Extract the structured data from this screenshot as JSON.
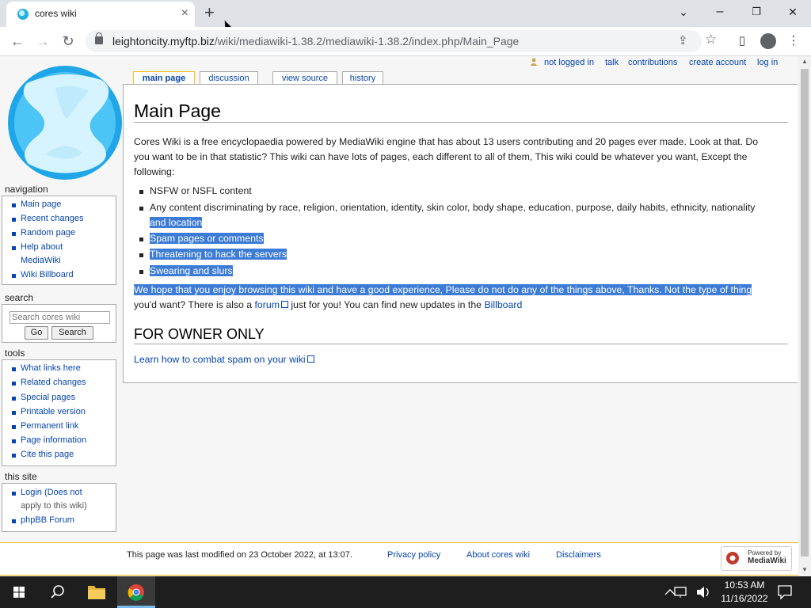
{
  "browser": {
    "tab_title": "cores wiki",
    "tab_close": "×",
    "new_tab": "+",
    "url_host": "leightoncity.myftp.biz",
    "url_path": "/wiki/mediawiki-1.38.2/mediawiki-1.38.2/index.php/Main_Page",
    "buttons": {
      "back": "←",
      "forward": "→",
      "reload": "↻",
      "minimize": "–",
      "restore": "❐",
      "close": "✕",
      "tab_search": "⌄",
      "menu": "⋮",
      "share": "⇪",
      "star": "☆",
      "sidepanel": "▯"
    }
  },
  "personal": {
    "not_logged_in": "not logged in",
    "talk": "talk",
    "contributions": "contributions",
    "create_account": "create account",
    "log_in": "log in"
  },
  "page_tabs": {
    "main_page": "main page",
    "discussion": "discussion",
    "view_source": "view source",
    "history": "history"
  },
  "article": {
    "title": "Main Page",
    "intro_1": "Cores Wiki is a free encyclopaedia powered by MediaWiki engine that has about 13 users contributing and 20 pages ever made. Look at that. Do",
    "intro_2": "you want to be in that statistic? This wiki can have lots of pages, each different to all of them, This wiki could be whatever you want, Except the",
    "intro_3": "following:",
    "list": [
      "NSFW or NSFL content",
      "Any content discriminating by race, religion, orientation, identity, skin color, body shape, education, purpose, daily habits, ethnicity, nationality",
      "and location",
      "Spam pages or comments",
      "Threatening to hack the servers",
      "Swearing and slurs"
    ],
    "outro_1": "We hope that you enjoy browsing this wiki and have a good experience, Please do not do any of the things above, Thanks. Not the type of thing",
    "outro_2a": "you'd want? There is also a ",
    "outro_forum": "forum",
    "outro_2b": " just for you! You can find new updates in the ",
    "outro_billboard": "Billboard",
    "h2": "FOR OWNER ONLY",
    "spam_link": "Learn how to combat spam on your wiki"
  },
  "sidebar": {
    "navigation": {
      "title": "navigation",
      "items": [
        "Main page",
        "Recent changes",
        "Random page",
        "Help about",
        "MediaWiki",
        "Wiki Billboard"
      ]
    },
    "search": {
      "title": "search",
      "placeholder": "Search cores wiki",
      "go": "Go",
      "search": "Search"
    },
    "tools": {
      "title": "tools",
      "items": [
        "What links here",
        "Related changes",
        "Special pages",
        "Printable version",
        "Permanent link",
        "Page information",
        "Cite this page"
      ]
    },
    "this_site": {
      "title": "this site",
      "items": [
        "Login (Does not",
        "apply to this wiki)",
        "phpBB Forum"
      ]
    }
  },
  "footer": {
    "last_modified": "This page was last modified on 23 October 2022, at 13:07.",
    "privacy": "Privacy policy",
    "about": "About cores wiki",
    "disclaimers": "Disclaimers",
    "powered_small": "Powered by",
    "powered_big": "MediaWiki"
  },
  "taskbar": {
    "time": "10:53 AM",
    "date": "11/16/2022"
  },
  "colors": {
    "selection": "#3d7cd6",
    "link": "#0645ad",
    "tab_accent": "#fabd23"
  }
}
